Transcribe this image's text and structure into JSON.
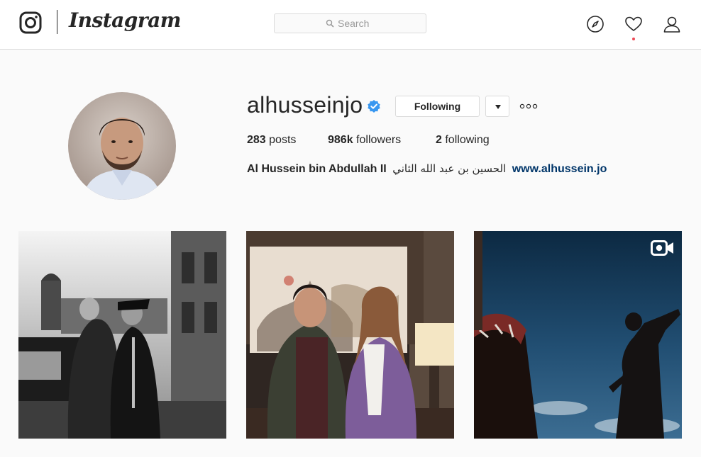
{
  "header": {
    "wordmark": "Instagram",
    "search_placeholder": "Search",
    "nav_icons": [
      "compass-icon",
      "heart-icon",
      "user-icon"
    ],
    "notification_dot_color": "#ed4956"
  },
  "profile": {
    "username": "alhusseinjo",
    "verified": true,
    "follow_button_label": "Following",
    "stats": {
      "posts_count": "283",
      "posts_label": "posts",
      "followers_count": "986k",
      "followers_label": "followers",
      "following_count": "2",
      "following_label": "following"
    },
    "bio": {
      "full_name": "Al Hussein bin Abdullah II",
      "arabic_name": "الحسين بن عبد الله الثاني",
      "website": "www.alhussein.jo"
    }
  },
  "posts": [
    {
      "kind": "photo",
      "icon": "none"
    },
    {
      "kind": "photo",
      "icon": "none"
    },
    {
      "kind": "video",
      "icon": "video-camera-icon"
    }
  ],
  "colors": {
    "background": "#fafafa",
    "border": "#dbdbdb",
    "text": "#262626",
    "verified_blue": "#3897f0",
    "link": "#003569"
  }
}
